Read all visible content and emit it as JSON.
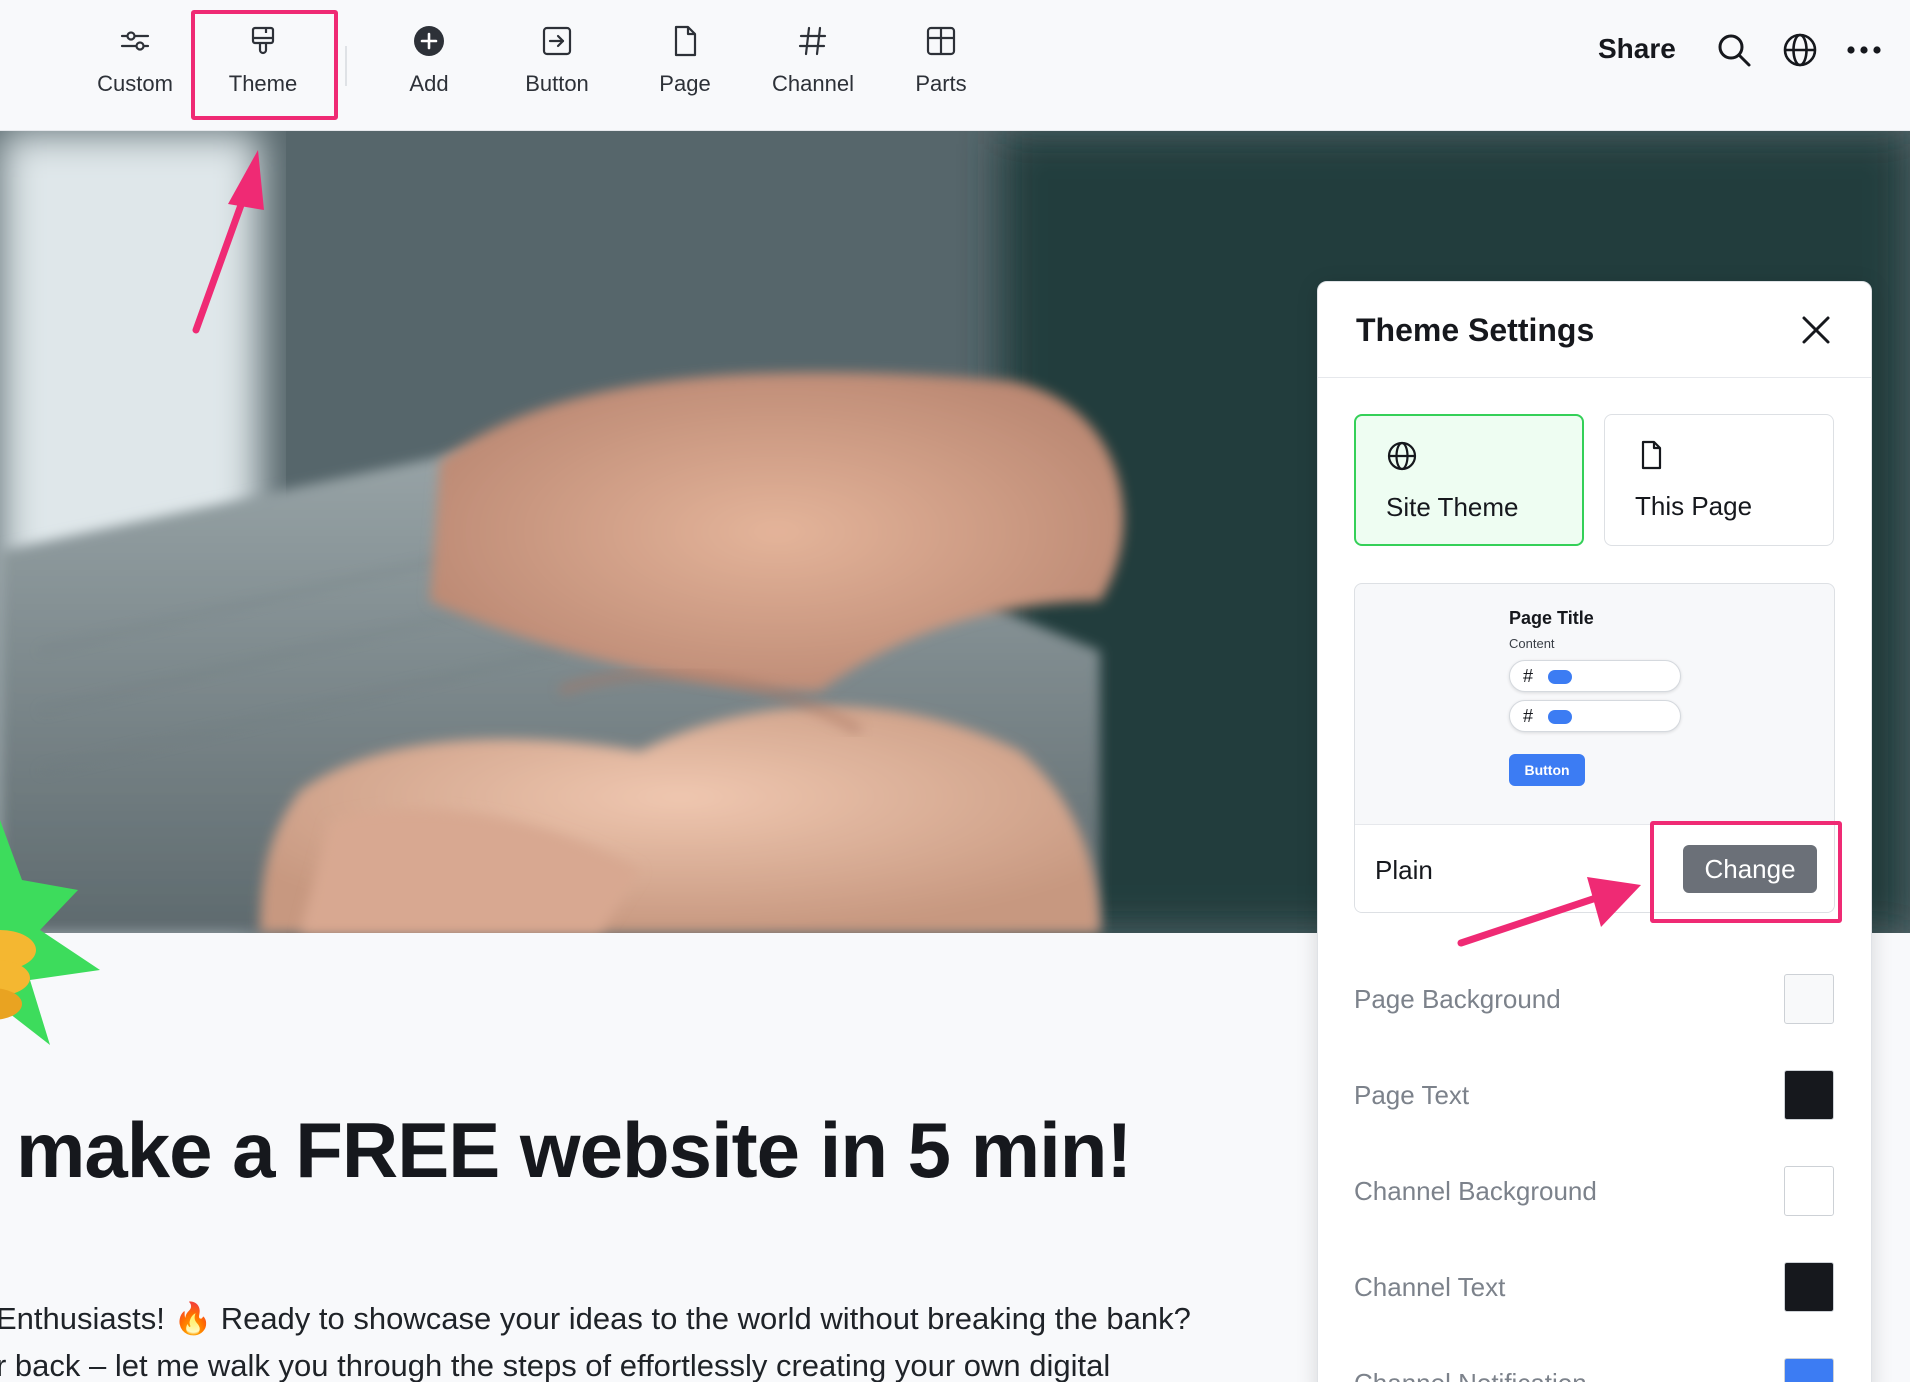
{
  "toolbar": {
    "tools": [
      {
        "label": "Custom",
        "icon": "sliders-icon"
      },
      {
        "label": "Theme",
        "icon": "paintbrush-icon"
      },
      {
        "label": "Add",
        "icon": "plus-circle-icon"
      },
      {
        "label": "Button",
        "icon": "button-arrow-icon"
      },
      {
        "label": "Page",
        "icon": "page-icon"
      },
      {
        "label": "Channel",
        "icon": "hash-icon"
      },
      {
        "label": "Parts",
        "icon": "layout-icon"
      }
    ],
    "share_label": "Share",
    "right_icons": [
      "search-icon",
      "globe-icon",
      "more-icon"
    ]
  },
  "page": {
    "headline": "make a FREE website in 5 min!",
    "body_lines": [
      "Enthusiasts! 🔥 Ready to showcase your ideas to the world without breaking the bank?",
      "r back – let me walk you through the steps of effortlessly creating your own digital"
    ]
  },
  "theme_settings": {
    "title": "Theme Settings",
    "scopes": [
      {
        "label": "Site Theme",
        "icon": "globe-icon",
        "active": true
      },
      {
        "label": "This Page",
        "icon": "page-icon",
        "active": false
      }
    ],
    "preview": {
      "page_title": "Page Title",
      "content_label": "Content",
      "channel_symbol": "#",
      "button_label": "Button"
    },
    "theme_name": "Plain",
    "change_label": "Change",
    "colors": [
      {
        "label": "Page Background",
        "color": "#f8f9fa"
      },
      {
        "label": "Page Text",
        "color": "#16181d"
      },
      {
        "label": "Channel Background",
        "color": "#ffffff"
      },
      {
        "label": "Channel Text",
        "color": "#16181d"
      },
      {
        "label": "Channel Notification",
        "color": "#3c7cf3"
      }
    ]
  },
  "accent_colors": {
    "highlight": "#ef2a74",
    "active_border": "#34d058",
    "primary_blue": "#3c7cf3"
  }
}
